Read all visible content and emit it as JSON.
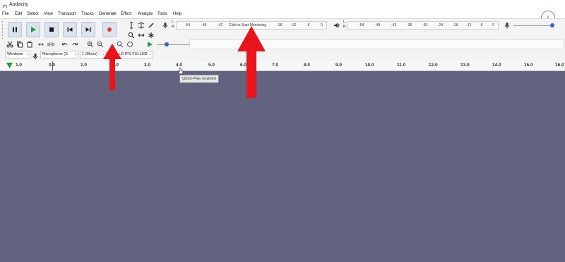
{
  "window": {
    "title": "Audacity"
  },
  "menu": [
    "File",
    "Edit",
    "Select",
    "View",
    "Transport",
    "Tracks",
    "Generate",
    "Effect",
    "Analyze",
    "Tools",
    "Help"
  ],
  "transport": {
    "buttons": [
      "pause",
      "play",
      "stop",
      "skip-to-start",
      "skip-to-end",
      "record"
    ]
  },
  "record_meter": {
    "prompt": "Click to Start Monitoring",
    "left_ticks": [
      "-54",
      "-48",
      "-42",
      "-18",
      "-12",
      "-6",
      "0"
    ],
    "right_ticks": [
      "-12",
      "-6",
      "0"
    ],
    "lr_labels": [
      "L",
      "R"
    ]
  },
  "playback_meter": {
    "ticks": [
      "-54",
      "-48",
      "-42",
      "-36",
      "-30",
      "-24",
      "-18",
      "-12",
      "-6",
      "0"
    ],
    "lr_labels": [
      "L",
      "R"
    ]
  },
  "device_toolbar": {
    "host": "Windows",
    "input": "Microphone (S",
    "channels": "1 (Mono)",
    "output": "LG IPS FULLHD"
  },
  "ruler": {
    "labels": [
      "1.0",
      "0.0",
      "1.0",
      "2.0",
      "3.0",
      "4.0",
      "5.0",
      "6.0",
      "7.0",
      "8.0",
      "9.0",
      "10.0",
      "11.0",
      "12.0",
      "13.0",
      "14.0",
      "15.0",
      "16.0"
    ]
  },
  "tooltip": "Quick-Play enabled",
  "info_glyph": "i",
  "colors": {
    "workspace": "#62637f",
    "record": "#e03a3a",
    "play": "#2e9a3b",
    "annotation_arrow": "#e8161c"
  }
}
